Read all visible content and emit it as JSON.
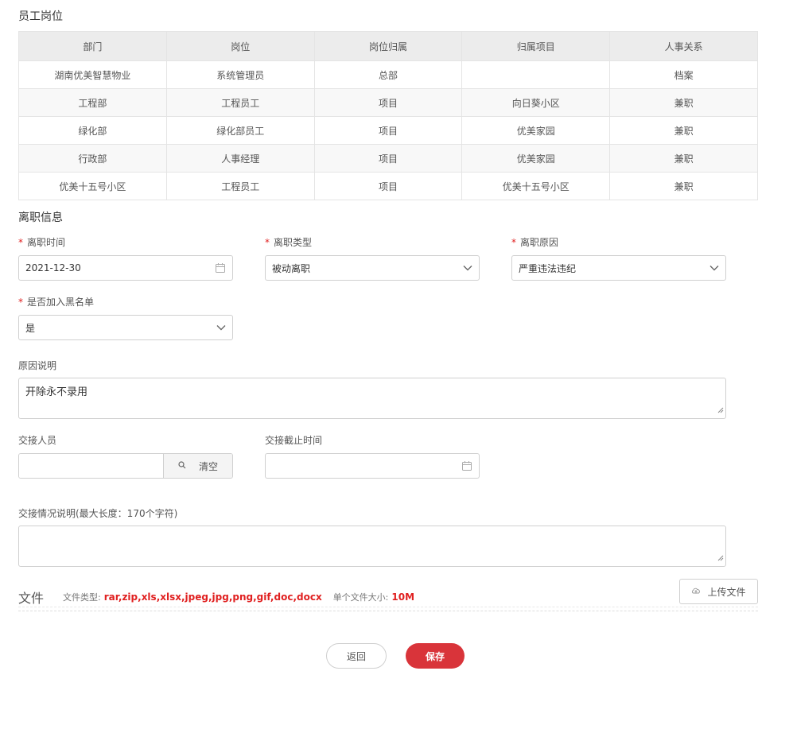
{
  "positions_section": {
    "title": "员工岗位",
    "columns": [
      "部门",
      "岗位",
      "岗位归属",
      "归属项目",
      "人事关系"
    ],
    "rows": [
      [
        "湖南优美智慧物业",
        "系统管理员",
        "总部",
        "",
        "档案"
      ],
      [
        "工程部",
        "工程员工",
        "项目",
        "向日葵小区",
        "兼职"
      ],
      [
        "绿化部",
        "绿化部员工",
        "项目",
        "优美家园",
        "兼职"
      ],
      [
        "行政部",
        "人事经理",
        "项目",
        "优美家园",
        "兼职"
      ],
      [
        "优美十五号小区",
        "工程员工",
        "项目",
        "优美十五号小区",
        "兼职"
      ]
    ]
  },
  "resign_section": {
    "title": "离职信息",
    "resign_date": {
      "label": "离职时间",
      "value": "2021-12-30",
      "required_mark": "*"
    },
    "resign_type": {
      "label": "离职类型",
      "value": "被动离职",
      "required_mark": "*"
    },
    "resign_reason": {
      "label": "离职原因",
      "value": "严重违法违纪",
      "required_mark": "*"
    },
    "blacklist": {
      "label": "是否加入黑名单",
      "value": "是",
      "required_mark": "*"
    },
    "reason_desc": {
      "label": "原因说明",
      "value": "开除永不录用"
    },
    "handover_person": {
      "label": "交接人员",
      "value": "",
      "clear_label": "清空"
    },
    "handover_deadline": {
      "label": "交接截止时间",
      "value": ""
    },
    "handover_desc": {
      "label": "交接情况说明(最大长度：170个字符)",
      "value": ""
    }
  },
  "files": {
    "title": "文件",
    "types_label": "文件类型:",
    "types_value": "rar,zip,xls,xlsx,jpeg,jpg,png,gif,doc,docx",
    "size_label": "单个文件大小:",
    "size_value": "10M",
    "upload_label": "上传文件"
  },
  "actions": {
    "back_label": "返回",
    "save_label": "保存"
  },
  "colors": {
    "accent": "#d9343a",
    "required": "#e02020"
  }
}
